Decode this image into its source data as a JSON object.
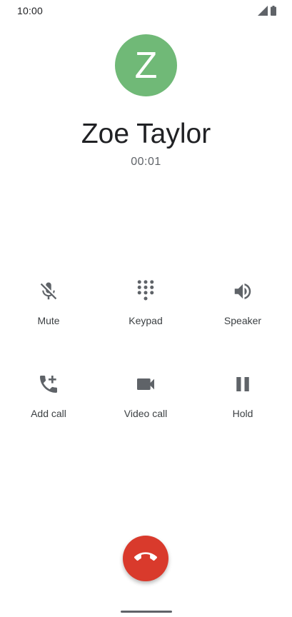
{
  "status_bar": {
    "time": "10:00",
    "icons": [
      "signal-icon",
      "battery-icon"
    ]
  },
  "contact": {
    "avatar_letter": "Z",
    "avatar_color": "#70b977",
    "name": "Zoe Taylor"
  },
  "call": {
    "timer": "00:01"
  },
  "controls": {
    "mute": {
      "label": "Mute",
      "icon": "mic-off-icon"
    },
    "keypad": {
      "label": "Keypad",
      "icon": "dialpad-icon"
    },
    "speaker": {
      "label": "Speaker",
      "icon": "volume-icon"
    },
    "add_call": {
      "label": "Add call",
      "icon": "add-call-icon"
    },
    "video_call": {
      "label": "Video call",
      "icon": "videocam-icon"
    },
    "hold": {
      "label": "Hold",
      "icon": "pause-icon"
    }
  },
  "end_call": {
    "icon": "call-end-icon",
    "color": "#d93a2c"
  }
}
